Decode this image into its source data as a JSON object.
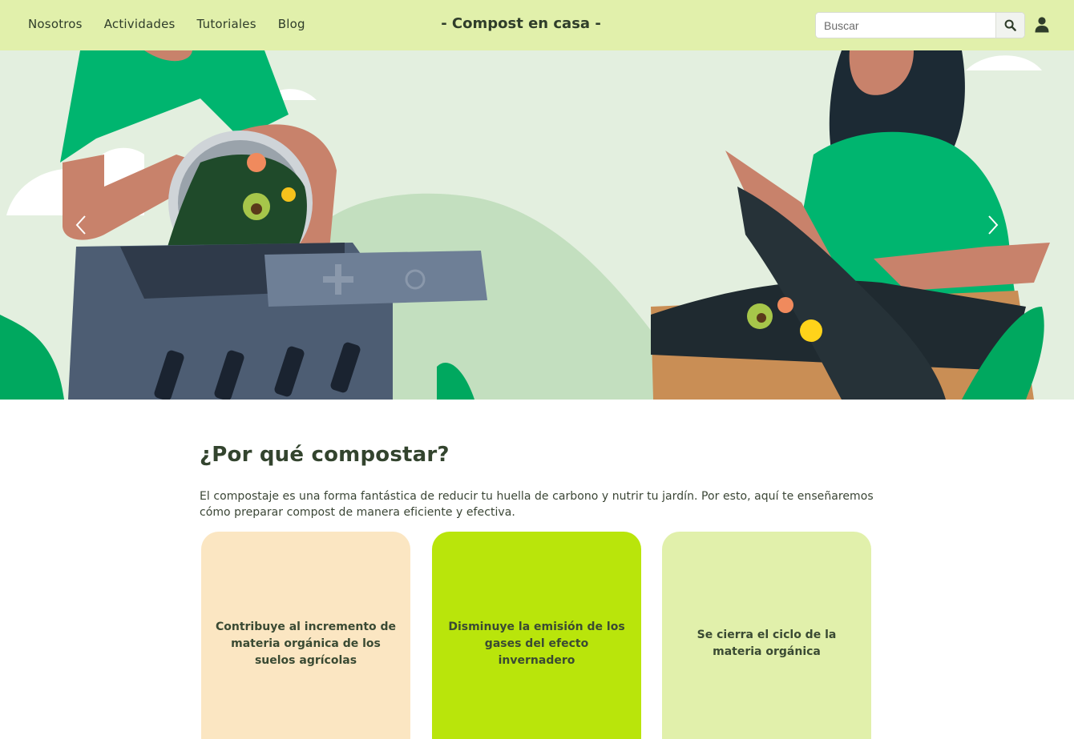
{
  "navbar": {
    "links": [
      "Nosotros",
      "Actividades",
      "Tutoriales",
      "Blog"
    ],
    "brand": "- Compost en casa -",
    "search_placeholder": "Buscar",
    "search_icon": "search-icon",
    "user_icon": "user-icon"
  },
  "hero": {
    "prev_icon": "chevron-left-icon",
    "next_icon": "chevron-right-icon"
  },
  "main": {
    "title": "¿Por qué compostar?",
    "intro": "El compostaje es una forma fantástica de reducir tu huella de carbono y nutrir tu jardín. Por esto, aquí te enseñaremos cómo preparar compost de manera eficiente y efectiva.",
    "cards": [
      {
        "text": "Contribuye al incremento de materia orgánica de los suelos agrícolas",
        "color": "#fbe6c2"
      },
      {
        "text": "Disminuye la emisión de los gases del efecto invernadero",
        "color": "#b9e50b"
      },
      {
        "text": "Se cierra el ciclo de la materia orgánica",
        "color": "#e1f0ab"
      }
    ]
  },
  "colors": {
    "navbar_bg": "#e1f0ab",
    "text_dark": "#33442e",
    "hero_bg": "#e3efdf",
    "shirt_green": "#00b56f"
  }
}
